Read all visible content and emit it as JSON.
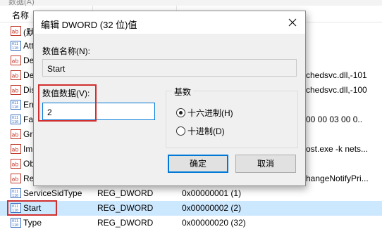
{
  "colors": {
    "selection": "#cce8ff",
    "annotation_red": "#d12f2f",
    "focus_blue": "#0078d7"
  },
  "header": {
    "top_partial": "数据(A)",
    "col_name": "名称"
  },
  "list": {
    "rows_partial": [
      {
        "name": "(默",
        "icon": "string-value-icon"
      },
      {
        "name": "Att",
        "icon": "binary-value-icon"
      },
      {
        "name": "De",
        "icon": "string-value-icon"
      },
      {
        "name": "De",
        "icon": "string-value-icon"
      },
      {
        "name": "Dis",
        "icon": "string-value-icon"
      },
      {
        "name": "Err",
        "icon": "binary-value-icon"
      },
      {
        "name": "Fai",
        "icon": "binary-value-icon"
      },
      {
        "name": "Gr",
        "icon": "string-value-icon"
      },
      {
        "name": "Im",
        "icon": "string-value-icon"
      },
      {
        "name": "Ob",
        "icon": "string-value-icon"
      },
      {
        "name": "Re",
        "icon": "string-value-icon"
      }
    ],
    "right_partial": {
      "desc_dll": "chedsvc.dll,-101",
      "disp_dll": "chedsvc.dll,-100",
      "fail_bytes": "00 00 03 00 0..",
      "image_path": "ost.exe -k nets...",
      "req_priv": "hangeNotifyPri..."
    },
    "rows": [
      {
        "name": "ServiceSidType",
        "type": "REG_DWORD",
        "data": "0x00000001 (1)",
        "icon": "binary-value-icon"
      },
      {
        "name": "Start",
        "type": "REG_DWORD",
        "data": "0x00000002 (2)",
        "icon": "binary-value-icon"
      },
      {
        "name": "Type",
        "type": "REG_DWORD",
        "data": "0x00000020 (32)",
        "icon": "binary-value-icon"
      }
    ]
  },
  "dialog": {
    "title": "编辑 DWORD (32 位)值",
    "close_icon": "close-icon",
    "value_name_label": "数值名称(N):",
    "value_name": "Start",
    "value_data_label": "数值数据(V):",
    "value_data": "2",
    "base_label": "基数",
    "hex_label": "十六进制(H)",
    "dec_label": "十进制(D)",
    "selected_base": "hex",
    "ok_label": "确定",
    "cancel_label": "取消"
  }
}
